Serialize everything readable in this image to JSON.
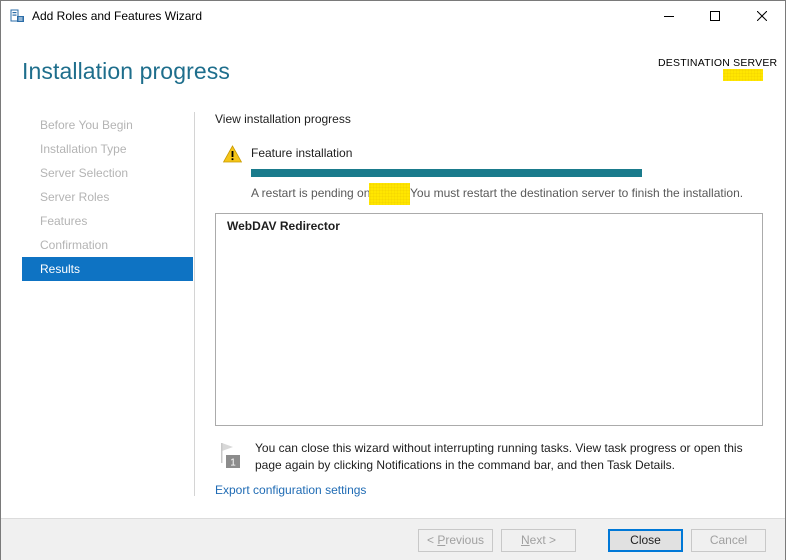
{
  "window": {
    "title": "Add Roles and Features Wizard",
    "accent_color": "#0e73c3",
    "title_color": "#1e6e8c"
  },
  "header": {
    "page_title": "Installation progress",
    "destination_label": "DESTINATION SERVER"
  },
  "nav": {
    "items": [
      {
        "label": "Before You Begin",
        "active": false
      },
      {
        "label": "Installation Type",
        "active": false
      },
      {
        "label": "Server Selection",
        "active": false
      },
      {
        "label": "Server Roles",
        "active": false
      },
      {
        "label": "Features",
        "active": false
      },
      {
        "label": "Confirmation",
        "active": false
      },
      {
        "label": "Results",
        "active": true
      }
    ]
  },
  "main": {
    "section_label": "View installation progress",
    "feature_label": "Feature installation",
    "progress_fraction": 1.0,
    "progress_color": "#1a7b8c",
    "restart_pre": "A restart is pending on",
    "restart_post": "You must restart the destination server to finish the installation.",
    "results": [
      {
        "name": "WebDAV Redirector"
      }
    ],
    "info_text": "You can close this wizard without interrupting running tasks. View task progress or open this page again by clicking Notifications in the command bar, and then Task Details.",
    "export_link": "Export configuration settings"
  },
  "footer": {
    "previous": {
      "pre": "< ",
      "key": "P",
      "post": "revious"
    },
    "next": {
      "key": "N",
      "post": "ext >"
    },
    "close": "Close",
    "cancel": "Cancel"
  },
  "icons": {
    "warning": "warning-icon",
    "flag": "notification-flag-icon"
  }
}
